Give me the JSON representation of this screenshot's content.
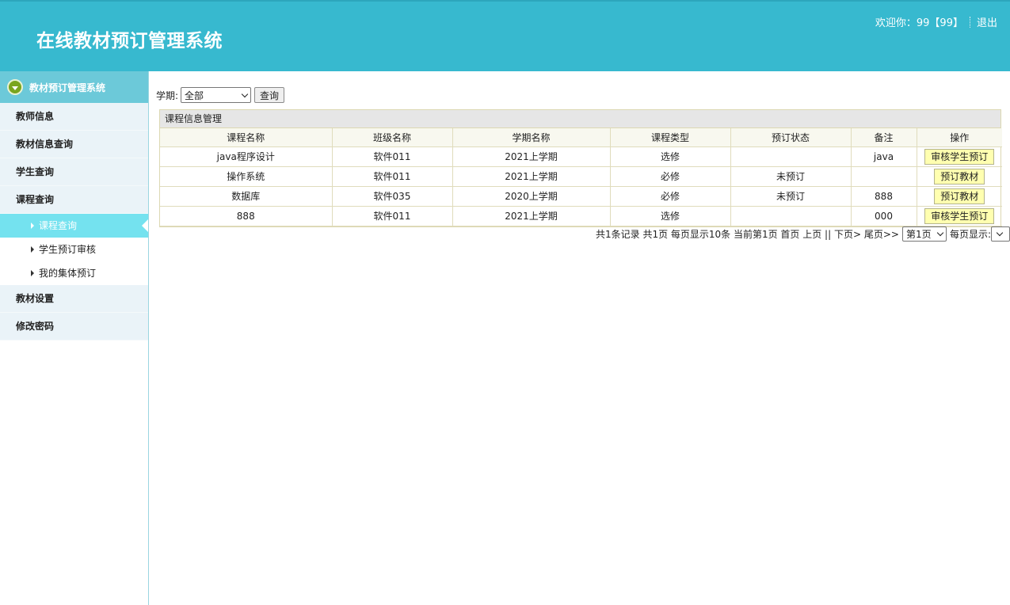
{
  "header": {
    "title": "在线教材预订管理系统",
    "welcome": "欢迎你：99【99】",
    "logout": "退出"
  },
  "sidebar": {
    "head": "教材预订管理系统",
    "items": [
      {
        "label": "教师信息"
      },
      {
        "label": "教材信息查询"
      },
      {
        "label": "学生查询"
      },
      {
        "label": "课程查询"
      }
    ],
    "subitems": [
      {
        "label": "课程查询"
      },
      {
        "label": "学生预订审核"
      },
      {
        "label": "我的集体预订"
      }
    ],
    "items_after": [
      {
        "label": "教材设置"
      },
      {
        "label": "修改密码"
      }
    ]
  },
  "filter": {
    "label": "学期:",
    "semester_value": "全部",
    "query_button": "查询"
  },
  "panel": {
    "title": "课程信息管理",
    "columns": [
      "课程名称",
      "班级名称",
      "学期名称",
      "课程类型",
      "预订状态",
      "备注",
      "操作"
    ],
    "rows": [
      {
        "course": "java程序设计",
        "class": "软件011",
        "semester": "2021上学期",
        "type": "选修",
        "status": "",
        "note": "java",
        "action": "审核学生预订"
      },
      {
        "course": "操作系统",
        "class": "软件011",
        "semester": "2021上学期",
        "type": "必修",
        "status": "未预订",
        "note": "",
        "action": "预订教材"
      },
      {
        "course": "数据库",
        "class": "软件035",
        "semester": "2020上学期",
        "type": "必修",
        "status": "未预订",
        "note": "888",
        "action": "预订教材"
      },
      {
        "course": "888",
        "class": "软件011",
        "semester": "2021上学期",
        "type": "选修",
        "status": "",
        "note": "000",
        "action": "审核学生预订"
      }
    ]
  },
  "pager": {
    "summary": "共1条记录 共1页 每页显示10条 当前第1页 首页 上页 || 下页> 尾页>>",
    "page_select": "第1页",
    "per_page_label": "每页显示:"
  }
}
